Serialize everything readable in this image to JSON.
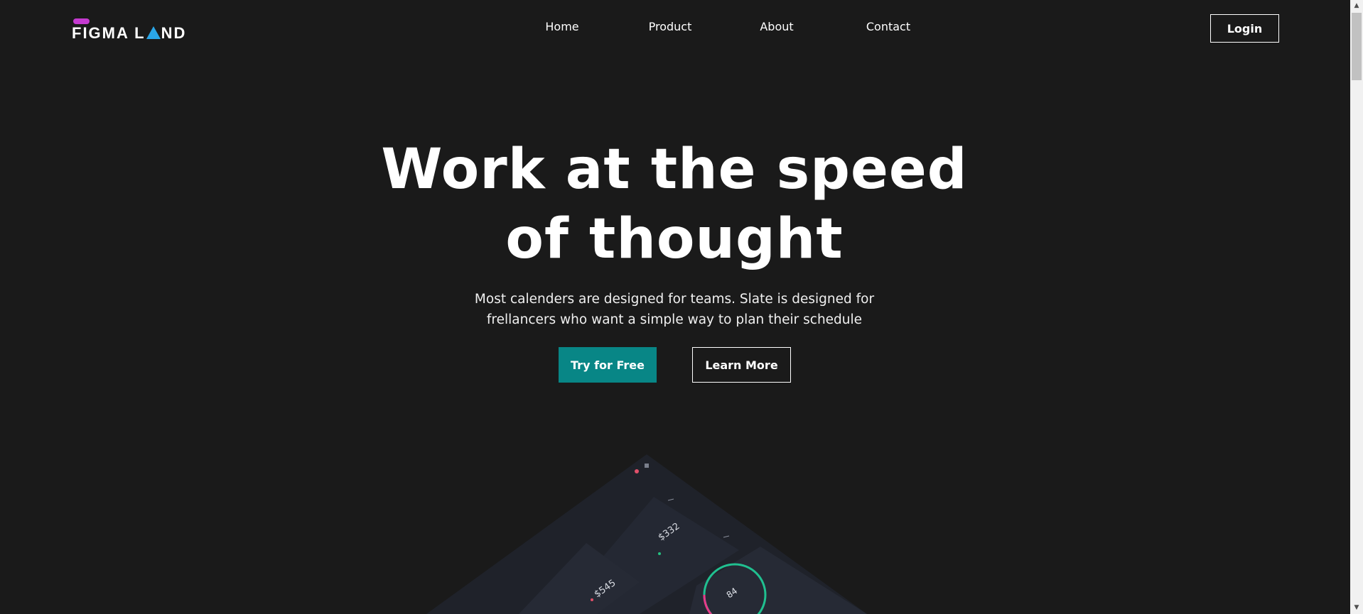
{
  "nav": {
    "logo_text_left": "FIGMA L",
    "logo_text_right": "ND",
    "links": [
      "Home",
      "Product",
      "About",
      "Contact"
    ],
    "login_label": "Login"
  },
  "hero": {
    "title_line1": "Work at the speed",
    "title_line2": "of thought",
    "subtitle_line1": "Most calenders are designed for teams. Slate is designed for",
    "subtitle_line2": "frellancers who want a simple way to plan their schedule",
    "primary_cta": "Try for Free",
    "secondary_cta": "Learn More"
  },
  "mockup": {
    "stat_1": "$545",
    "stat_2": "$332",
    "gauge_value": "84"
  },
  "colors": {
    "background": "#1a1a1a",
    "accent": "#088686",
    "logo_pill": "#c43ad0",
    "logo_triangle": "#2aa6e8"
  }
}
